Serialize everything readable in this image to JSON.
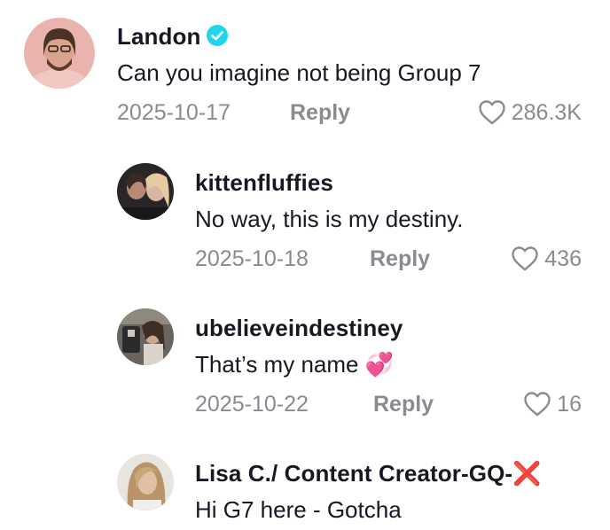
{
  "comments": [
    {
      "username": "Landon",
      "verified": true,
      "text": "Can you imagine not being Group 7",
      "date": "2025-10-17",
      "reply_label": "Reply",
      "likes": "286.3K",
      "avatar_icon": "avatar-photo"
    },
    {
      "username": "kittenfluffies",
      "text": "No way, this is my destiny.",
      "date": "2025-10-18",
      "reply_label": "Reply",
      "likes": "436",
      "avatar_icon": "avatar-photo"
    },
    {
      "username": "ubelieveindestiney",
      "text": "That’s my name 💞",
      "date": "2025-10-22",
      "reply_label": "Reply",
      "likes": "16",
      "avatar_icon": "avatar-photo"
    },
    {
      "username": "Lisa C./ Content Creator-GQ-❌",
      "text": "Hi G7 here - Gotcha",
      "avatar_icon": "avatar-photo"
    }
  ],
  "colors": {
    "primary_text": "#161823",
    "secondary_text": "#8a8b91",
    "verified_badge": "#20d5ec"
  }
}
